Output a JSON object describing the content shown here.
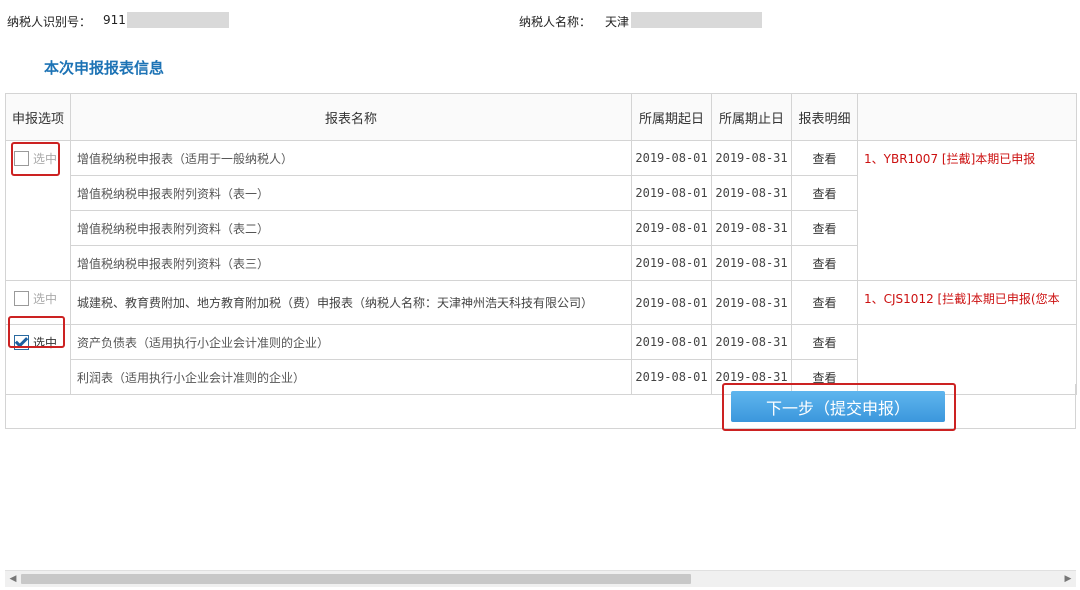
{
  "header": {
    "taxpayer_id_label": "纳税人识别号：",
    "taxpayer_id_value": "911",
    "taxpayer_name_label": "纳税人名称：",
    "taxpayer_name_value": "天津"
  },
  "section_title": "本次申报报表信息",
  "table": {
    "columns": [
      "申报选项",
      "报表名称",
      "所属期起日",
      "所属期止日",
      "报表明细",
      ""
    ],
    "groups": [
      {
        "option_label": "选中",
        "checked": false,
        "message": "1、YBR1007 [拦截]本期已申报",
        "rows": [
          {
            "name": "增值税纳税申报表（适用于一般纳税人）",
            "start": "2019-08-01",
            "end": "2019-08-31",
            "detail": "查看"
          },
          {
            "name": "增值税纳税申报表附列资料（表一）",
            "start": "2019-08-01",
            "end": "2019-08-31",
            "detail": "查看"
          },
          {
            "name": "增值税纳税申报表附列资料（表二）",
            "start": "2019-08-01",
            "end": "2019-08-31",
            "detail": "查看"
          },
          {
            "name": "增值税纳税申报表附列资料（表三）",
            "start": "2019-08-01",
            "end": "2019-08-31",
            "detail": "查看"
          }
        ]
      },
      {
        "option_label": "选中",
        "checked": false,
        "message": "1、CJS1012 [拦截]本期已申报(您本",
        "rows": [
          {
            "name": "城建税、教育费附加、地方教育附加税（费）申报表（纳税人名称：天津神州浩天科技有限公司）",
            "start": "2019-08-01",
            "end": "2019-08-31",
            "detail": "查看"
          }
        ]
      },
      {
        "option_label": "选中",
        "checked": true,
        "message": "",
        "rows": [
          {
            "name": "资产负债表（适用执行小企业会计准则的企业）",
            "start": "2019-08-01",
            "end": "2019-08-31",
            "detail": "查看"
          },
          {
            "name": "利润表（适用执行小企业会计准则的企业）",
            "start": "2019-08-01",
            "end": "2019-08-31",
            "detail": "查看"
          }
        ]
      }
    ]
  },
  "submit_button": "下一步（提交申报）",
  "colors": {
    "accent": "#1d73b5",
    "error": "#cc1111",
    "button": "#3b97dc",
    "highlight": "#cc2222"
  }
}
